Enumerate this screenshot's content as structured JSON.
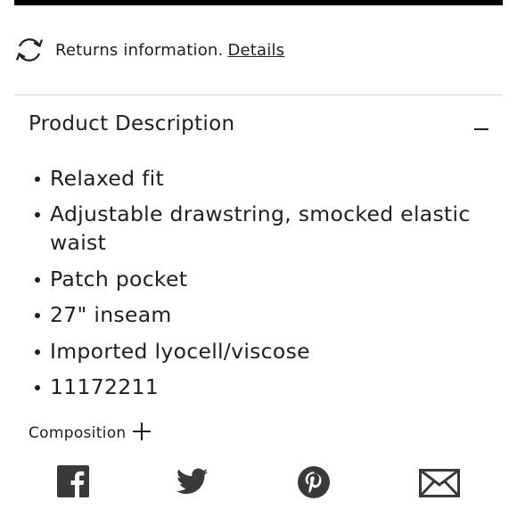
{
  "returns": {
    "text": "Returns information.",
    "link": "Details",
    "icon": "refresh-icon"
  },
  "description": {
    "title": "Product Description",
    "toggle_icon": "minus-icon",
    "items": [
      "Relaxed fit",
      "Adjustable drawstring, smocked elastic waist",
      "Patch pocket",
      "27\" inseam",
      "Imported lyocell/viscose",
      "11172211"
    ]
  },
  "composition": {
    "label": "Composition",
    "toggle_icon": "plus-icon"
  },
  "share": {
    "icons": [
      "facebook-icon",
      "twitter-icon",
      "pinterest-icon",
      "email-icon"
    ],
    "color": "#3a3a3a"
  },
  "colors": {
    "text": "#1f1f1f",
    "divider": "#d6d6d6",
    "topbar": "#000000"
  }
}
